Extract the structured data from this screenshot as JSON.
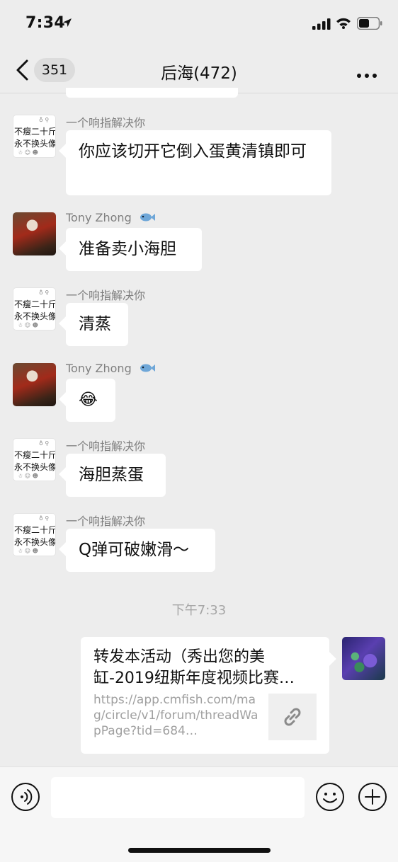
{
  "status_bar": {
    "time": "7:34"
  },
  "nav": {
    "back_badge": "351",
    "title": "后海(472)"
  },
  "messages": [
    {
      "sender": "一个响指解决你",
      "text": "你应该切开它倒入蛋黄清镇即可"
    },
    {
      "sender": "Tony Zhong",
      "text": "准备卖小海胆"
    },
    {
      "sender": "一个响指解决你",
      "text": "清蒸"
    },
    {
      "sender": "Tony Zhong",
      "text": "😂"
    },
    {
      "sender": "一个响指解决你",
      "text": "海胆蒸蛋"
    },
    {
      "sender": "一个响指解决你",
      "text": "Q弹可破嫩滑～"
    }
  ],
  "avatar_text": {
    "line1": "不瘦二十斤",
    "line2": "永不换头像"
  },
  "timestamp": "下午7:33",
  "link_card": {
    "title": "转发本活动（秀出您的美缸-2019纽斯年度视频比赛…",
    "url": "https://app.cmfish.com/mag/circle/v1/forum/threadWapPage?tid=684…"
  },
  "input": {
    "placeholder": ""
  }
}
